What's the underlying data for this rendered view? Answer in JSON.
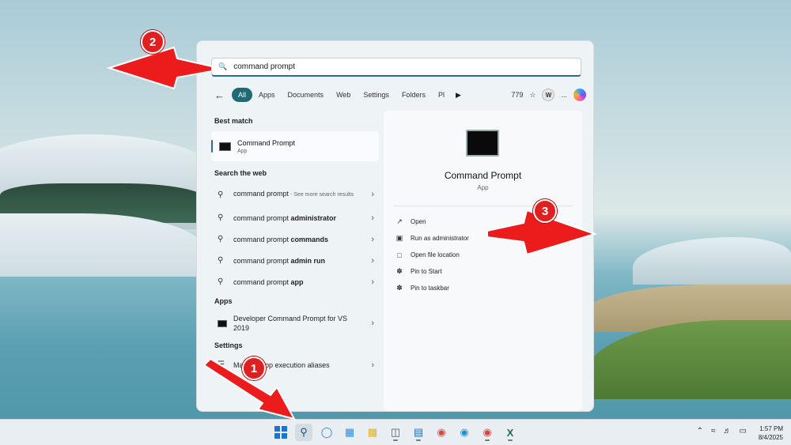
{
  "search": {
    "value": "command prompt",
    "icon": "search-icon"
  },
  "filters": {
    "tabs": [
      "All",
      "Apps",
      "Documents",
      "Web",
      "Settings",
      "Folders",
      "Pl"
    ],
    "count": "779",
    "user_initial": "W",
    "more": "..."
  },
  "left": {
    "best_match_heading": "Best match",
    "best_match": {
      "title": "Command Prompt",
      "subtitle": "App"
    },
    "web_heading": "Search the web",
    "web_items": [
      {
        "query": "command prompt",
        "bold": "",
        "suffix": " - See more search results"
      },
      {
        "query": "command prompt ",
        "bold": "administrator",
        "suffix": ""
      },
      {
        "query": "command prompt ",
        "bold": "commands",
        "suffix": ""
      },
      {
        "query": "command prompt ",
        "bold": "admin run",
        "suffix": ""
      },
      {
        "query": "command prompt ",
        "bold": "app",
        "suffix": ""
      }
    ],
    "apps_heading": "Apps",
    "apps": [
      {
        "title": "Developer Command Prompt for VS 2019"
      }
    ],
    "settings_heading": "Settings",
    "settings": [
      {
        "title": "Manage app execution aliases"
      }
    ]
  },
  "right": {
    "title": "Command Prompt",
    "subtitle": "App",
    "actions": [
      {
        "label": "Open",
        "icon": "open-icon"
      },
      {
        "label": "Run as administrator",
        "icon": "shield-icon"
      },
      {
        "label": "Open file location",
        "icon": "folder-icon"
      },
      {
        "label": "Pin to Start",
        "icon": "pin-icon"
      },
      {
        "label": "Pin to taskbar",
        "icon": "pin-icon"
      }
    ]
  },
  "annotations": [
    "1",
    "2",
    "3"
  ],
  "taskbar": {
    "time": "1:57 PM",
    "date": "8/4/2025"
  },
  "colors": {
    "accent": "#1f6b73",
    "annotation": "#e02020"
  }
}
